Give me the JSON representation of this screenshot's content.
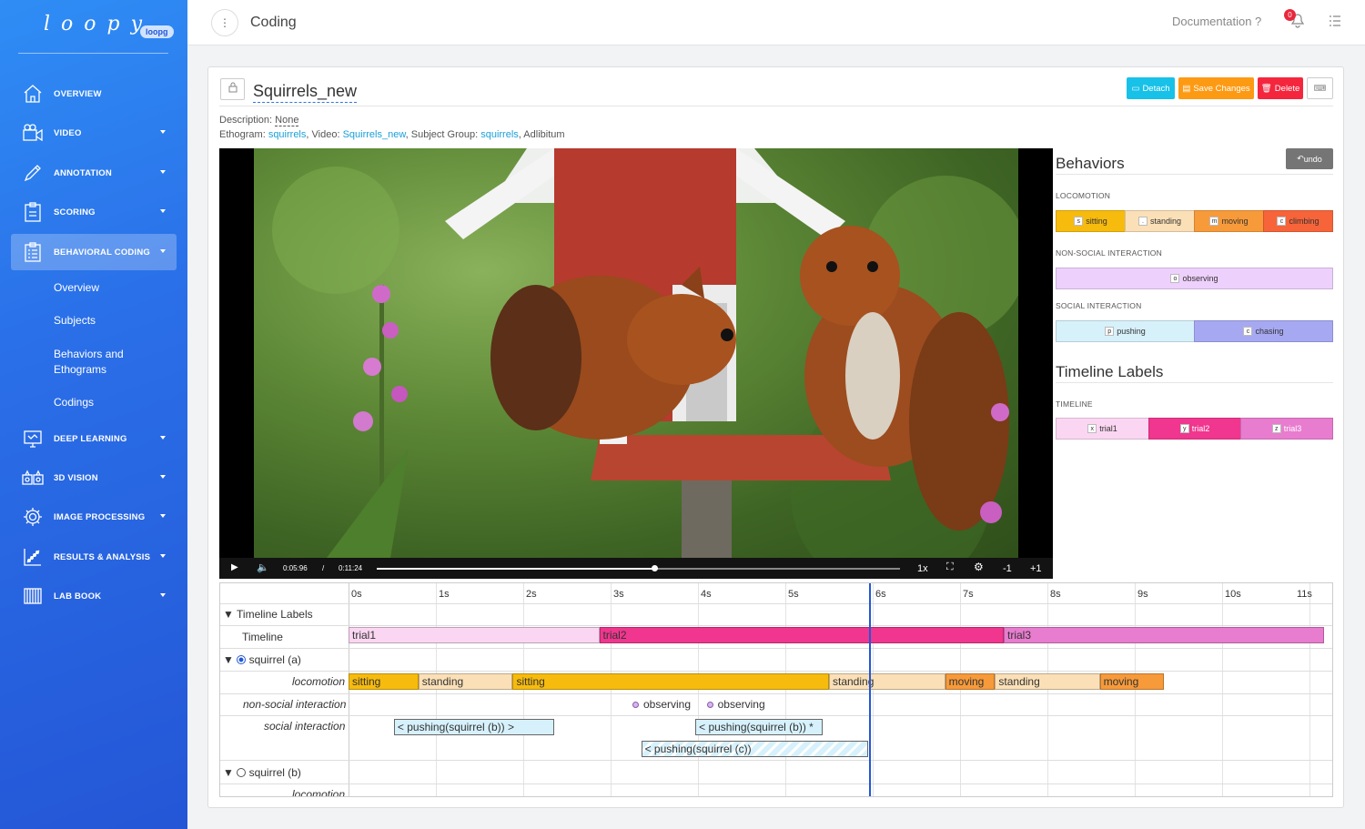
{
  "app": {
    "logo_text": "loopy",
    "logo_badge": "loopg"
  },
  "sidebar": {
    "items": [
      {
        "label": "OVERVIEW",
        "icon": "home-icon"
      },
      {
        "label": "VIDEO",
        "icon": "video-camera-icon"
      },
      {
        "label": "ANNOTATION",
        "icon": "pencil-icon"
      },
      {
        "label": "SCORING",
        "icon": "clipboard-icon"
      },
      {
        "label": "BEHAVIORAL CODING",
        "icon": "clipboard-list-icon",
        "active": true
      },
      {
        "label": "DEEP LEARNING",
        "icon": "monitor-icon"
      },
      {
        "label": "3D VISION",
        "icon": "stereo-camera-icon"
      },
      {
        "label": "IMAGE PROCESSING",
        "icon": "gear-icon"
      },
      {
        "label": "RESULTS & ANALYSIS",
        "icon": "scatter-chart-icon"
      },
      {
        "label": "LAB BOOK",
        "icon": "book-icon"
      }
    ],
    "subitems": [
      "Overview",
      "Subjects",
      "Behaviors and Ethograms",
      "Codings"
    ]
  },
  "topbar": {
    "title": "Coding",
    "documentation": "Documentation ?",
    "notification_count": "0"
  },
  "coding": {
    "name": "Squirrels_new",
    "buttons": {
      "detach": "Detach",
      "save": "Save Changes",
      "delete": "Delete"
    },
    "description_label": "Description:",
    "description_value": "None",
    "ethogram_label": "Ethogram:",
    "ethogram_value": "squirrels",
    "video_label": ", Video:",
    "video_value": "Squirrels_new",
    "subject_group_label": ", Subject Group:",
    "subject_group_value": "squirrels",
    "mode": ", Adlibitum"
  },
  "player": {
    "current_time": "0:05:96",
    "separator": "/",
    "duration": "0:11:24",
    "speed": "1x",
    "back": "-1",
    "forward": "+1",
    "progress": 0.53
  },
  "behaviors": {
    "title": "Behaviors",
    "undo": "undo",
    "groups": [
      {
        "name": "LOCOMOTION",
        "items": [
          {
            "key": "s",
            "label": "sitting",
            "color": "#f7bb0d"
          },
          {
            "key": ".",
            "label": "standing",
            "color": "#fbe0b7"
          },
          {
            "key": "m",
            "label": "moving",
            "color": "#f79a3a"
          },
          {
            "key": "c",
            "label": "climbing",
            "color": "#f7643a"
          }
        ]
      },
      {
        "name": "NON-SOCIAL INTERACTION",
        "items": [
          {
            "key": "o",
            "label": "observing",
            "color": "#edd0fb"
          }
        ]
      },
      {
        "name": "SOCIAL INTERACTION",
        "items": [
          {
            "key": "p",
            "label": "pushing",
            "color": "#d7f1fb"
          },
          {
            "key": "c",
            "label": "chasing",
            "color": "#a6a9f2"
          }
        ]
      }
    ]
  },
  "timeline_labels": {
    "title": "Timeline Labels",
    "group": "TIMELINE",
    "items": [
      {
        "key": "x",
        "label": "trial1",
        "color": "#fbd6f2"
      },
      {
        "key": "y",
        "label": "trial2",
        "color": "#f0368e"
      },
      {
        "key": "z",
        "label": "trial3",
        "color": "#e87ccf"
      }
    ]
  },
  "timeline": {
    "ticks": [
      "0s",
      "1s",
      "2s",
      "3s",
      "4s",
      "5s",
      "6s",
      "7s",
      "8s",
      "9s",
      "10s",
      "11s"
    ],
    "group_timeline": "Timeline Labels",
    "row_timeline": "Timeline",
    "subject_a": "squirrel (a)",
    "subject_b": "squirrel (b)",
    "row_locomotion": "locomotion",
    "row_nonsocial": "non-social interaction",
    "row_social": "social interaction",
    "trials": [
      {
        "label": "trial1",
        "start": 0.0,
        "end": 2.87,
        "color": "#fbd6f2"
      },
      {
        "label": "trial2",
        "start": 2.87,
        "end": 7.5,
        "color": "#f0368e"
      },
      {
        "label": "trial3",
        "start": 7.5,
        "end": 11.17,
        "color": "#e87ccf"
      }
    ],
    "locomotion": [
      {
        "label": "sitting",
        "start": 0.0,
        "end": 0.8,
        "color": "#f7bb0d"
      },
      {
        "label": "standing",
        "start": 0.8,
        "end": 1.88,
        "color": "#fbe0b7"
      },
      {
        "label": "sitting",
        "start": 1.88,
        "end": 5.5,
        "color": "#f7bb0d"
      },
      {
        "label": "standing",
        "start": 5.5,
        "end": 6.83,
        "color": "#fbe0b7"
      },
      {
        "label": "moving",
        "start": 6.83,
        "end": 7.4,
        "color": "#f79a3a"
      },
      {
        "label": "standing",
        "start": 7.4,
        "end": 8.6,
        "color": "#fbe0b7"
      },
      {
        "label": "moving",
        "start": 8.6,
        "end": 9.33,
        "color": "#f79a3a"
      }
    ],
    "nonsocial": [
      {
        "label": "observing",
        "at": 3.25
      },
      {
        "label": "observing",
        "at": 4.1
      }
    ],
    "social": [
      {
        "label": "< pushing(squirrel (b)) >",
        "start": 0.52,
        "end": 2.35,
        "row": 0
      },
      {
        "label": "< pushing(squirrel (b)) *",
        "start": 3.97,
        "end": 5.43,
        "row": 0
      },
      {
        "label": "< pushing(squirrel (c))",
        "start": 3.35,
        "end": 5.95,
        "row": 1,
        "hatched": true
      }
    ],
    "cursor": 5.96
  }
}
